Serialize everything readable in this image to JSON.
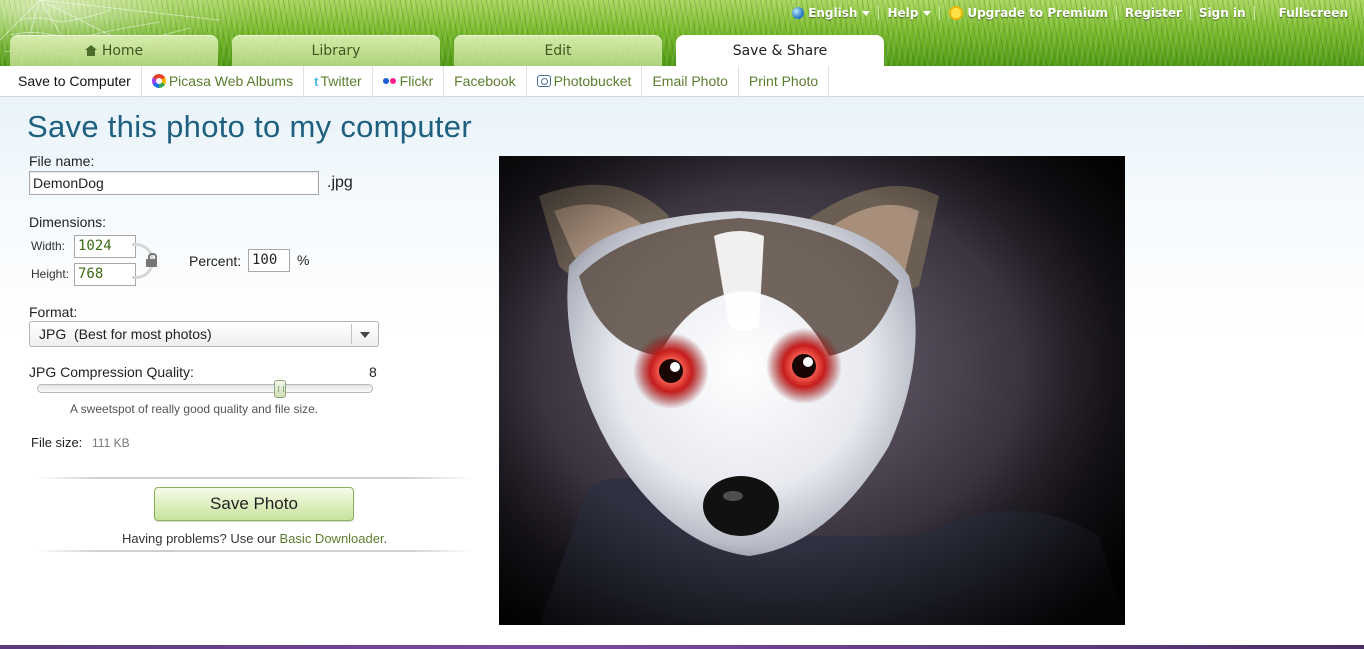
{
  "topbar": {
    "language": "English",
    "help": "Help",
    "premium": "Upgrade to Premium",
    "register": "Register",
    "signin": "Sign in",
    "fullscreen": "Fullscreen"
  },
  "main_tabs": [
    {
      "label": "Home",
      "active": false
    },
    {
      "label": "Library",
      "active": false
    },
    {
      "label": "Edit",
      "active": false
    },
    {
      "label": "Save & Share",
      "active": true
    }
  ],
  "sub_nav": [
    {
      "label": "Save to Computer",
      "active": true
    },
    {
      "label": "Picasa Web Albums",
      "icon": "picasa-icon"
    },
    {
      "label": "Twitter",
      "icon": "twitter-icon"
    },
    {
      "label": "Flickr",
      "icon": "flickr-icon"
    },
    {
      "label": "Facebook"
    },
    {
      "label": "Photobucket",
      "icon": "photobucket-icon"
    },
    {
      "label": "Email Photo"
    },
    {
      "label": "Print Photo"
    }
  ],
  "page": {
    "title": "Save this photo to my computer",
    "file_name_label": "File name:",
    "file_name_value": "DemonDog",
    "extension": ".jpg",
    "dimensions_label": "Dimensions:",
    "width_label": "Width:",
    "width_value": "1024",
    "height_label": "Height:",
    "height_value": "768",
    "percent_label": "Percent:",
    "percent_value": "100",
    "percent_unit": "%",
    "format_label": "Format:",
    "format_value": "JPG  (Best for most photos)",
    "quality_label": "JPG Compression Quality:",
    "quality_value": "8",
    "quality_hint": "A sweetspot of really good quality and file size.",
    "file_size_label": "File size:",
    "file_size_value": "111 KB",
    "save_button": "Save Photo",
    "problems_text": "Having problems? Use our ",
    "problems_link": "Basic Downloader",
    "problems_end": "."
  },
  "colors": {
    "title": "#1f5f7f",
    "link_green": "#5a7e2e",
    "save_button": "#c7e39b"
  }
}
